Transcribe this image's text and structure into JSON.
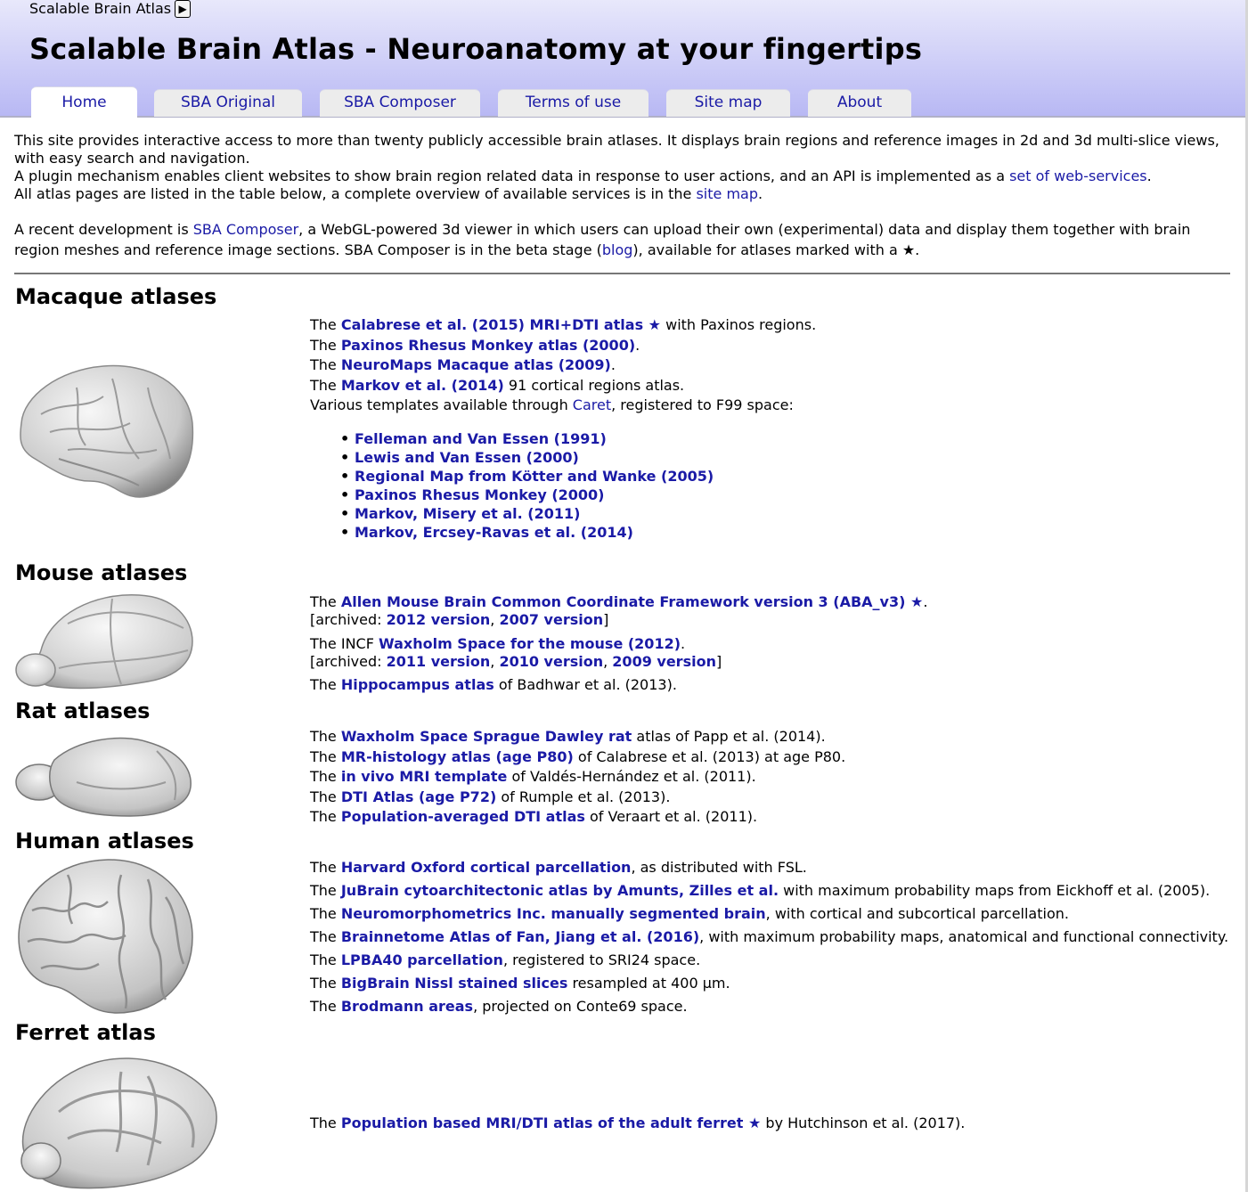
{
  "header": {
    "breadcrumb": "Scalable Brain Atlas",
    "breadcrumb_icon": "play-icon",
    "title": "Scalable Brain Atlas - Neuroanatomy at your fingertips"
  },
  "tabs": [
    {
      "label": "Home"
    },
    {
      "label": "SBA Original"
    },
    {
      "label": "SBA Composer"
    },
    {
      "label": "Terms of use"
    },
    {
      "label": "Site map"
    },
    {
      "label": "About"
    }
  ],
  "intro": {
    "line1": "This site provides interactive access to more than twenty publicly accessible brain atlases. It displays brain regions and reference images in 2d and 3d multi-slice views, with easy search and navigation.",
    "line2_pre": "A plugin mechanism enables client websites to show brain region related data in response to user actions, and an API is implemented as a ",
    "line2_link": "set of web-services",
    "line2_post": ".",
    "line3_pre": "All atlas pages are listed in the table below, a complete overview of available services is in the ",
    "line3_link": "site map",
    "line3_post": ".",
    "p2_pre": "A recent development is ",
    "p2_link1": "SBA Composer",
    "p2_mid": ", a WebGL-powered 3d viewer in which users can upload their own (experimental) data and display them together with brain region meshes and reference image sections. SBA Composer is in the beta stage (",
    "p2_link2": "blog",
    "p2_post": "), available for atlases marked with a ★."
  },
  "sections": {
    "macaque": {
      "heading": "Macaque atlases",
      "rows": [
        {
          "pre": "The ",
          "link": "Calabrese et al. (2015) MRI+DTI atlas ★",
          "post": " with Paxinos regions."
        },
        {
          "pre": "The ",
          "link": "Paxinos Rhesus Monkey atlas (2000)",
          "post": "."
        },
        {
          "pre": "The ",
          "link": "NeuroMaps Macaque atlas (2009)",
          "post": "."
        },
        {
          "pre": "The ",
          "link": "Markov et al. (2014)",
          "post": " 91 cortical regions atlas."
        },
        {
          "pre": "Various templates available through ",
          "link": "Caret",
          "post": ", registered to F99 space:"
        }
      ],
      "templates": [
        "Felleman and Van Essen (1991)",
        "Lewis and Van Essen (2000)",
        "Regional Map from Kötter and Wanke (2005)",
        "Paxinos Rhesus Monkey (2000)",
        "Markov, Misery et al. (2011)",
        "Markov, Ercsey-Ravas et al. (2014)"
      ]
    },
    "mouse": {
      "heading": "Mouse atlases",
      "r1_pre": "The ",
      "r1_link": "Allen Mouse Brain Common Coordinate Framework version 3 (ABA_v3) ★",
      "r1_post": ".",
      "r2_pre": "[archived: ",
      "r2_l1": "2012 version",
      "r2_sep": ", ",
      "r2_l2": "2007 version",
      "r2_post": "]",
      "r3_pre": "The INCF ",
      "r3_link": "Waxholm Space for the mouse (2012)",
      "r3_post": ".",
      "r4_pre": "[archived: ",
      "r4_l1": "2011 version",
      "r4_sep1": ", ",
      "r4_l2": "2010 version",
      "r4_sep2": ", ",
      "r4_l3": "2009 version",
      "r4_post": "]",
      "r5_pre": "The ",
      "r5_link": "Hippocampus atlas",
      "r5_post": " of Badhwar et al. (2013)."
    },
    "rat": {
      "heading": "Rat atlases",
      "rows": [
        {
          "pre": "The ",
          "link": "Waxholm Space Sprague Dawley rat",
          "post": " atlas of Papp et al. (2014)."
        },
        {
          "pre": "The ",
          "link": "MR-histology atlas (age P80)",
          "post": " of Calabrese et al. (2013) at age P80."
        },
        {
          "pre": "The ",
          "link": "in vivo MRI template",
          "post": " of Valdés-Hernández et al. (2011)."
        },
        {
          "pre": "The ",
          "link": "DTI Atlas (age P72)",
          "post": " of Rumple et al. (2013)."
        },
        {
          "pre": "The ",
          "link": "Population-averaged DTI atlas",
          "post": " of Veraart et al. (2011)."
        }
      ]
    },
    "human": {
      "heading": "Human atlases",
      "rows": [
        {
          "pre": "The ",
          "link": "Harvard Oxford cortical parcellation",
          "post": ", as distributed with FSL."
        },
        {
          "pre": "The ",
          "link": "JuBrain cytoarchitectonic atlas by Amunts, Zilles et al.",
          "post": " with maximum probability maps from Eickhoff et al. (2005)."
        },
        {
          "pre": "The ",
          "link": "Neuromorphometrics Inc. manually segmented brain",
          "post": ", with cortical and subcortical parcellation."
        },
        {
          "pre": "The ",
          "link": "Brainnetome Atlas of Fan, Jiang et al. (2016)",
          "post": ", with maximum probability maps, anatomical and functional connectivity."
        },
        {
          "pre": "The ",
          "link": "LPBA40 parcellation",
          "post": ", registered to SRI24 space."
        },
        {
          "pre": "The ",
          "link": "BigBrain Nissl stained slices",
          "post": " resampled at 400 µm."
        },
        {
          "pre": "The ",
          "link": "Brodmann areas",
          "post": ", projected on Conte69 space."
        }
      ]
    },
    "ferret": {
      "heading": "Ferret atlas",
      "rows": [
        {
          "pre": "The ",
          "link": "Population based MRI/DTI atlas of the adult ferret ★",
          "post": " by Hutchinson et al. (2017)."
        }
      ]
    }
  }
}
